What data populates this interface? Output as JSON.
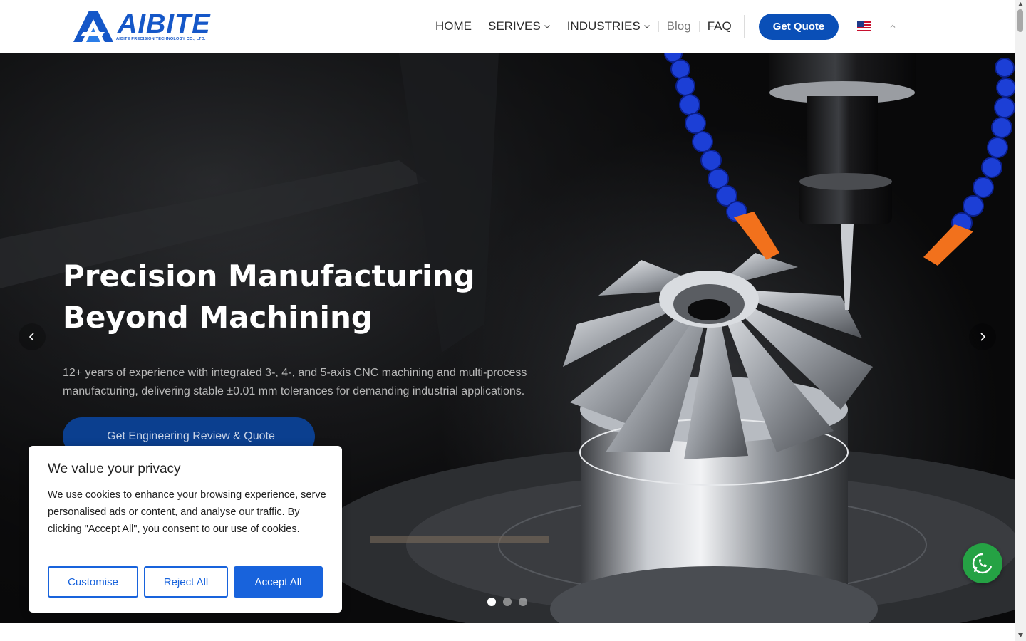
{
  "brand": {
    "name": "AIBITE",
    "subtitle": "AIBITE PRECISION TECHNOLOGY CO., LTD.",
    "color": "#1557c8"
  },
  "nav": {
    "items": [
      {
        "label": "HOME",
        "has_dropdown": false
      },
      {
        "label": "SERIVES",
        "has_dropdown": true
      },
      {
        "label": "INDUSTRIES",
        "has_dropdown": true
      },
      {
        "label": "Blog",
        "has_dropdown": false
      },
      {
        "label": "FAQ",
        "has_dropdown": false
      }
    ],
    "quote_label": "Get Quote",
    "language_icon": "us-flag-icon"
  },
  "hero": {
    "title_line1": "Precision Manufacturing",
    "title_line2": "Beyond Machining",
    "subtitle": "12+ years of experience with integrated 3-, 4-, and 5-axis CNC machining and multi-process manufacturing, delivering stable ±0.01 mm tolerances for demanding industrial applications.",
    "cta_icon": "",
    "cta_label": "Get Engineering Review & Quote",
    "slides_count": 3,
    "active_slide": 1
  },
  "cookie": {
    "title": "We value your privacy",
    "text": "We use cookies to enhance your browsing experience, serve personalised ads or content, and analyse our traffic. By clicking \"Accept All\", you consent to our use of cookies.",
    "customise_label": "Customise",
    "reject_label": "Reject All",
    "accept_label": "Accept All",
    "accent": "#1863dc"
  },
  "colors": {
    "primary_button": "#0a4fb7",
    "whatsapp": "#25a244"
  }
}
